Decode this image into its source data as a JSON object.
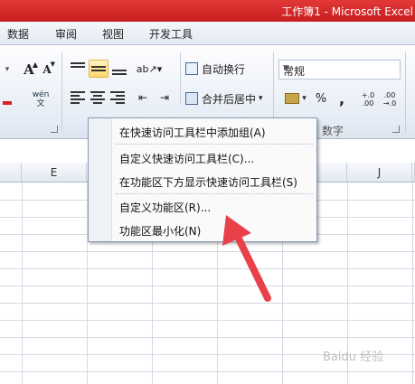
{
  "window": {
    "title": "工作簿1 - Microsoft Excel"
  },
  "tabs": [
    "数据",
    "审阅",
    "视图",
    "开发工具"
  ],
  "ribbon": {
    "font_grow": "A",
    "font_shrink": "A",
    "phonetic": "wén\n文",
    "wrap_text": "自动换行",
    "merge_center": "合并后居中",
    "number_format": "常规",
    "percent": "%",
    "comma": ",",
    "increase_decimal": "+.0\n.00",
    "decrease_decimal": ".00\n→.0",
    "number_group_label": "数字"
  },
  "columns": [
    "E",
    "J"
  ],
  "context_menu": {
    "items": [
      "在快速访问工具栏中添加组(A)",
      "自定义快速访问工具栏(C)...",
      "在功能区下方显示快速访问工具栏(S)",
      "自定义功能区(R)...",
      "功能区最小化(N)"
    ]
  },
  "watermark": "Baidu 经验",
  "colors": {
    "title_bar": "#d42828",
    "arrow": "#e8414a",
    "highlight": "#ffd970"
  }
}
